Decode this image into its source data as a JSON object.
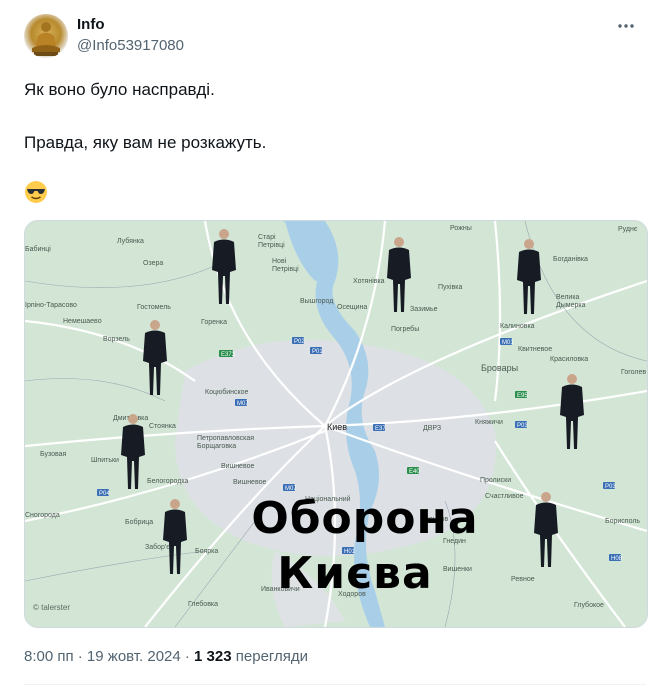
{
  "author": {
    "name": "Info",
    "handle": "@Info53917080"
  },
  "tweet": {
    "line1": "Як воно було насправді.",
    "line2": "Правда, яку вам не розкажуть.",
    "emoji": "😎"
  },
  "media": {
    "title_line1": "Оборона",
    "title_line2": "Києва",
    "watermark": "© talerster",
    "places": [
      "Лубянка",
      "Озера",
      "Бабинці",
      "Старі Петрівці",
      "Нові Петрівці",
      "Хотянівка",
      "Пухівка",
      "Рожны",
      "Богданівка",
      "Руднє",
      "Великая Дымерка",
      "Гостомель",
      "Немешаево",
      "Горенка",
      "Вышгород",
      "Осещина",
      "Зазимье",
      "Ворзель",
      "Погребы",
      "Калиновка",
      "Квитневое",
      "Красиловка",
      "Гоголев",
      "Бровары",
      "Коцюбинское",
      "Дмитровка",
      "Стоянка",
      "Петропавловская Борщаговка",
      "Киев",
      "ДВРЗ",
      "Княжичи",
      "Бузовая",
      "Шпитьки",
      "Белогородка",
      "Вишневое",
      "Процерв",
      "Счастливое",
      "Борисполь",
      "Боярка",
      "Ходосівка",
      "Гнедин",
      "Вишенки",
      "Ревное",
      "Глебовка",
      "Иванковичи",
      "Ходоров",
      "Бобрица",
      "Забор'є"
    ],
    "people_count": 10
  },
  "meta": {
    "time_date": "8:00 пп · 19 жовт. 2024 · ",
    "views_count": "1 323",
    "views_label": " перегляди"
  },
  "icons": {
    "more": "more-horizontal-icon",
    "avatar": "buddha-statue-avatar"
  }
}
